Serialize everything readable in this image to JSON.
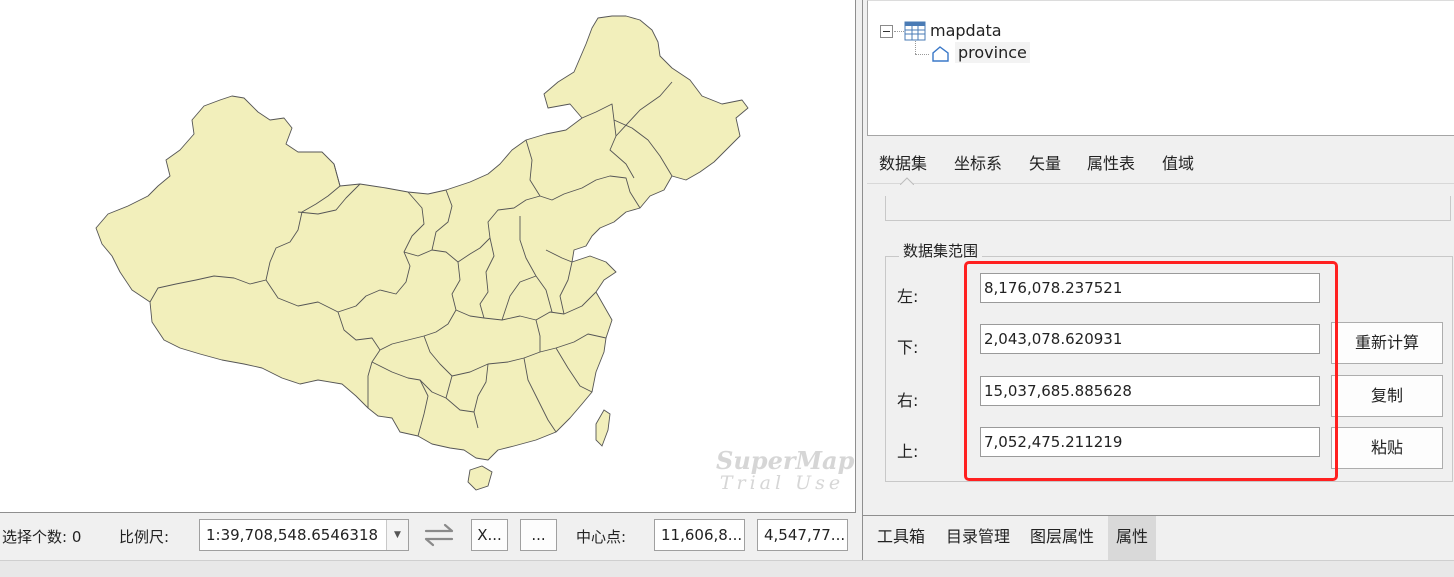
{
  "map": {
    "fill_color": "#f2efbb",
    "border_color": "#555555",
    "watermark": {
      "line1": "SuperMap",
      "line2": "Trial Use"
    }
  },
  "status_bar": {
    "selection_label": "选择个数: 0",
    "scale_label": "比例尺:",
    "scale_value": "1:39,708,548.6546318",
    "swap_icon": "swap-arrows-icon",
    "coord_button": "X...",
    "more_button": "...",
    "center_label": "中心点:",
    "center_x": "11,606,8...",
    "center_y": "4,547,77..."
  },
  "tree": {
    "datasource": "mapdata",
    "dataset": "province",
    "datasource_icon": "database-icon",
    "dataset_icon": "region-dataset-icon"
  },
  "prop_tabs": [
    "数据集",
    "坐标系",
    "矢量",
    "属性表",
    "值域"
  ],
  "range": {
    "title": "数据集范围",
    "left_label": "左:",
    "left_value": "8,176,078.237521",
    "bottom_label": "下:",
    "bottom_value": "2,043,078.620931",
    "right_label": "右:",
    "right_value": "15,037,685.885628",
    "top_label": "上:",
    "top_value": "7,052,475.211219",
    "recalc_button": "重新计算",
    "copy_button": "复制",
    "paste_button": "粘贴",
    "highlight_color": "#ff2020"
  },
  "bottom_tabs": [
    "工具箱",
    "目录管理",
    "图层属性",
    "属性"
  ],
  "active_bottom_tab": "属性"
}
